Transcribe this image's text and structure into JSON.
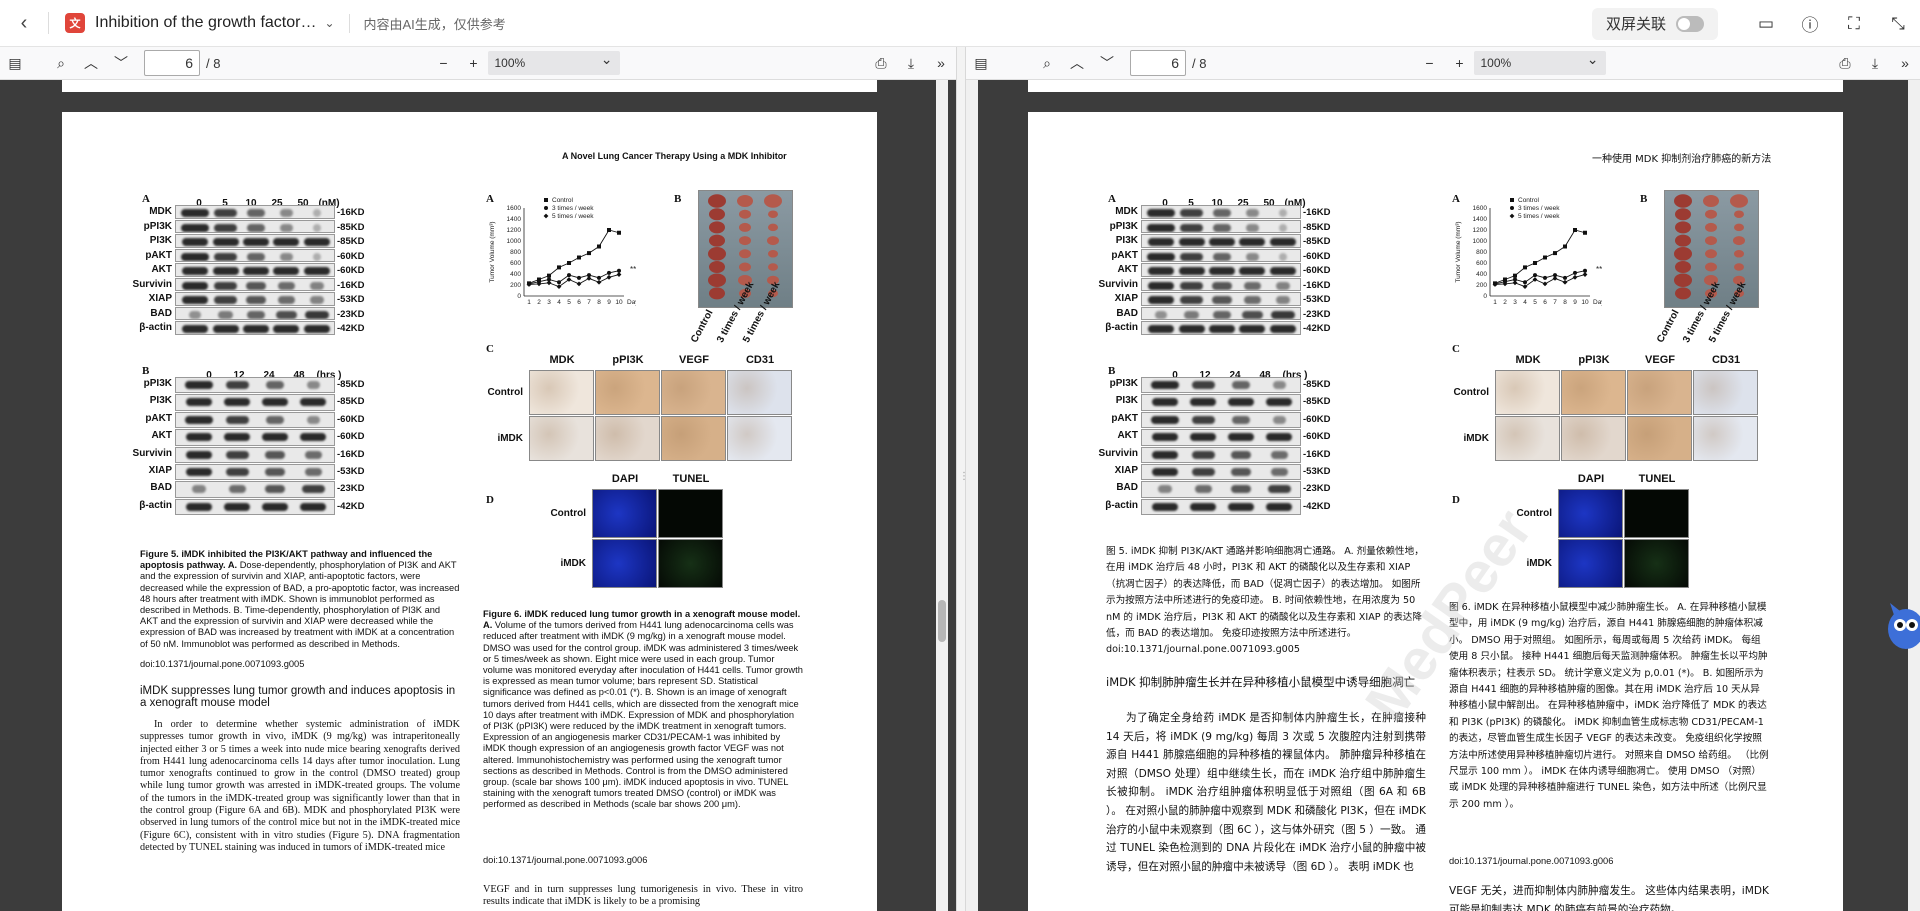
{
  "topbar": {
    "back_icon": "chevron-left-icon",
    "doc_title": "Inhibition of the growth factor…",
    "ai_note": "内容由AI生成，仅供参考",
    "dual_screen_label": "双屏关联"
  },
  "viewer_left": {
    "page_number": "6",
    "page_total": "/ 8",
    "zoom": "100%"
  },
  "viewer_right": {
    "page_number": "6",
    "page_total": "/ 8",
    "zoom": "100%"
  },
  "page_en": {
    "running_head": "A Novel Lung Cancer Therapy Using a MDK Inhibitor",
    "fig5": {
      "panel_a": "A",
      "panel_b": "B",
      "a_lanes": [
        "0",
        "5",
        "10",
        "25",
        "50",
        "(nM)"
      ],
      "b_lanes": [
        "0",
        "12",
        "24",
        "48",
        "(hrs )"
      ],
      "a_rows": [
        {
          "name": "MDK",
          "kd": "-16KD"
        },
        {
          "name": "pPI3K",
          "kd": "-85KD"
        },
        {
          "name": "PI3K",
          "kd": "-85KD"
        },
        {
          "name": "pAKT",
          "kd": "-60KD"
        },
        {
          "name": "AKT",
          "kd": "-60KD"
        },
        {
          "name": "Survivin",
          "kd": "-16KD"
        },
        {
          "name": "XIAP",
          "kd": "-53KD"
        },
        {
          "name": "BAD",
          "kd": "-23KD"
        },
        {
          "name": "β-actin",
          "kd": "-42KD"
        }
      ],
      "b_rows": [
        {
          "name": "pPI3K",
          "kd": "-85KD"
        },
        {
          "name": "PI3K",
          "kd": "-85KD"
        },
        {
          "name": "pAKT",
          "kd": "-60KD"
        },
        {
          "name": "AKT",
          "kd": "-60KD"
        },
        {
          "name": "Survivin",
          "kd": "-16KD"
        },
        {
          "name": "XIAP",
          "kd": "-53KD"
        },
        {
          "name": "BAD",
          "kd": "-23KD"
        },
        {
          "name": "β-actin",
          "kd": "-42KD"
        }
      ],
      "caption_bold": "Figure 5. iMDK inhibited the PI3K/AKT pathway and influenced the apoptosis pathway. A.",
      "caption_text": " Dose-dependently, phosphorylation of PI3K and AKT and the expression of survivin and XIAP, anti-apoptotic factors, were decreased while the expression of BAD, a pro-apoptotic factor, was increased 48 hours after treatment with iMDK. Shown is immunoblot performed as described in Methods. B. Time-dependently, phosphorylation of PI3K and AKT and the expression of survivin and XIAP were decreased while the expression of BAD was increased by treatment with iMDK at a concentration of 50 nM. Immunoblot was performed as described in Methods.",
      "doi": "doi:10.1371/journal.pone.0071093.g005"
    },
    "fig6": {
      "panel_a": "A",
      "panel_b": "B",
      "panel_c": "C",
      "panel_d": "D",
      "legend": [
        "Control",
        "3 times / week",
        "5 times / week"
      ],
      "ylabel": "Tumor Volume (mm³)",
      "xlabel": "Days",
      "sig": "**",
      "photo_labels": [
        "Control",
        "3 times / week",
        "5 times / week"
      ],
      "c_cols": [
        "MDK",
        "pPI3K",
        "VEGF",
        "CD31"
      ],
      "c_rows": [
        "Control",
        "iMDK"
      ],
      "d_cols": [
        "DAPI",
        "TUNEL"
      ],
      "d_rows": [
        "Control",
        "iMDK"
      ],
      "caption_bold": "Figure 6. iMDK reduced lung tumor growth in a xenograft mouse model. A.",
      "caption_text": " Volume of the tumors derived from H441 lung adenocarcinoma cells was reduced after treatment with iMDK (9 mg/kg) in a xenograft mouse model. DMSO was used for the control group. iMDK was administered 3 times/week or 5 times/week as shown. Eight mice were used in each group. Tumor volume was monitored everyday after inoculation of H441 cells. Tumor growth is expressed as mean tumor volume; bars represent SD. Statistical significance was defined as p<0.01 (*). B. Shown is an image of xenograft tumors derived from H441 cells, which are dissected from the xenograft mice 10 days after treatment with iMDK. Expression of MDK and phosphorylation of PI3K (pPI3K) were reduced by the iMDK treatment in xenograft tumors. Expression of an angiogenesis marker CD31/PECAM-1 was inhibited by iMDK though expression of an angiogenesis growth factor VEGF was not altered. Immunohistochemistry was performed using the xenograft tumor sections as described in Methods. Control is from the DMSO administered group. (scale bar shows 100 μm). iMDK induced apoptosis in vivo. TUNEL staining with the xenograft tumors treated DMSO (control) or iMDK was performed as described in Methods (scale bar shows 200 μm).",
      "doi": "doi:10.1371/journal.pone.0071093.g006"
    },
    "section_title": "iMDK suppresses lung tumor growth and induces apoptosis in a xenograft mouse model",
    "section_body": "In order to determine whether systemic administration of iMDK suppresses tumor growth in vivo, iMDK (9 mg/kg) was intraperitoneally injected either 3 or 5 times a week into nude mice bearing xenografts derived from H441 lung adenocarcinoma cells 14 days after tumor inoculation. Lung tumor xenografts continued to grow in the control (DMSO treated) group while lung tumor growth was arrested in iMDK-treated groups. The volume of the tumors in the iMDK-treated group was significantly lower than that in the control group (Figure 6A and 6B). MDK and phosphorylated PI3K were observed in lung tumors of the control mice but not in the iMDK-treated mice (Figure 6C), consistent with in vitro studies (Figure 5). DNA fragmentation detected by TUNEL staining was induced in tumors of iMDK-treated mice",
    "right_col_tail": "VEGF and in turn suppresses lung tumorigenesis in vivo. These in vitro results indicate that iMDK is likely to be a promising"
  },
  "page_cn": {
    "running_head": "一种使用 MDK 抑制剂治疗肺癌的新方法",
    "fig5_caption": "图 5. iMDK 抑制 PI3K/AKT 通路并影响细胞凋亡通路。 A. 剂量依赖性地，在用 iMDK 治疗后 48 小时，PI3K 和 AKT 的磷酸化以及生存素和 XIAP（抗凋亡因子）的表达降低，而 BAD（促凋亡因子）的表达增加。 如图所示为按照方法中所述进行的免疫印迹。 B. 时间依赖性地，在用浓度为 50 nM 的 iMDK 治疗后，PI3K 和 AKT 的磷酸化以及生存素和 XIAP 的表达降低，而 BAD 的表达增加。 免疫印迹按照方法中所述进行。 doi:10.1371/journal.pone.0071093.g005",
    "fig6_caption": "图 6. iMDK 在异种移植小鼠模型中减少肺肿瘤生长。 A. 在异种移植小鼠模型中，用 iMDK (9 mg/kg) 治疗后，源自 H441 肺腺癌细胞的肿瘤体积减小。 DMSO 用于对照组。 如图所示，每周或每周 5 次给药 iMDK。 每组使用 8 只小鼠。 接种 H441 细胞后每天监测肿瘤体积。 肿瘤生长以平均肿瘤体积表示；柱表示 SD。 统计学意义定义为 p,0.01 (*)。 B. 如图所示为源自 H441 细胞的异种移植肿瘤的图像。其在用 iMDK 治疗后 10 天从异种移植小鼠中解剖出。 在异种移植肿瘤中，iMDK 治疗降低了 MDK 的表达和 PI3K (pPI3K) 的磷酸化。 iMDK 抑制血管生成标志物 CD31/PECAM-1 的表达，尽管血管生成生长因子 VEGF 的表达未改变。 免疫组织化学按照方法中所述使用异种移植肿瘤切片进行。 对照来自 DMSO 给药组。 （比例尺显示 100 mm ）。 iMDK 在体内诱导细胞凋亡。 使用 DMSO （对照）或 iMDK 处理的异种移植肿瘤进行 TUNEL 染色，如方法中所述（比例尺显示 200 mm ）。",
    "fig6_doi": "doi:10.1371/journal.pone.0071093.g006",
    "section_title": "iMDK 抑制肺肿瘤生长并在异种移植小鼠模型中诱导细胞凋亡",
    "section_body": "为了确定全身给药 iMDK 是否抑制体内肿瘤生长，在肿瘤接种 14 天后，将 iMDK (9 mg/kg) 每周 3 次或 5 次腹腔内注射到携带源自 H441 肺腺癌细胞的异种移植的裸鼠体内。 肺肿瘤异种移植在对照（DMSO 处理）组中继续生长，而在 iMDK 治疗组中肺肿瘤生长被抑制。 iMDK 治疗组肿瘤体积明显低于对照组（图 6A 和 6B ）。 在对照小鼠的肺肿瘤中观察到 MDK 和磷酸化 PI3K，但在 iMDK 治疗的小鼠中未观察到（图 6C ），这与体外研究（图 5 ）一致。 通过 TUNEL 染色检测到的 DNA 片段化在 iMDK 治疗小鼠的肿瘤中被诱导，但在对照小鼠的肿瘤中未被诱导（图 6D ）。 表明 iMDK 也",
    "right_col_tail": "VEGF 无关，进而抑制体内肺肿瘤发生。 这些体内结果表明，iMDK 可能是抑制表达 MDK 的肺癌有前景的治疗药物。",
    "watermark": "MedPeer"
  },
  "chart_data": {
    "type": "line",
    "x": [
      1,
      2,
      3,
      4,
      5,
      6,
      7,
      8,
      9,
      10
    ],
    "xlabel": "Days",
    "ylabel": "Tumor Volume (mm³)",
    "ylim": [
      0,
      1600
    ],
    "yticks": [
      0,
      200,
      400,
      600,
      800,
      1000,
      1200,
      1400,
      1600
    ],
    "series": [
      {
        "name": "Control",
        "values": [
          230,
          300,
          370,
          520,
          600,
          700,
          780,
          900,
          1200,
          1150
        ]
      },
      {
        "name": "3 times / week",
        "values": [
          220,
          260,
          300,
          250,
          380,
          330,
          380,
          330,
          420,
          460
        ]
      },
      {
        "name": "5 times / week",
        "values": [
          210,
          220,
          240,
          170,
          300,
          220,
          320,
          250,
          340,
          390
        ]
      }
    ]
  }
}
